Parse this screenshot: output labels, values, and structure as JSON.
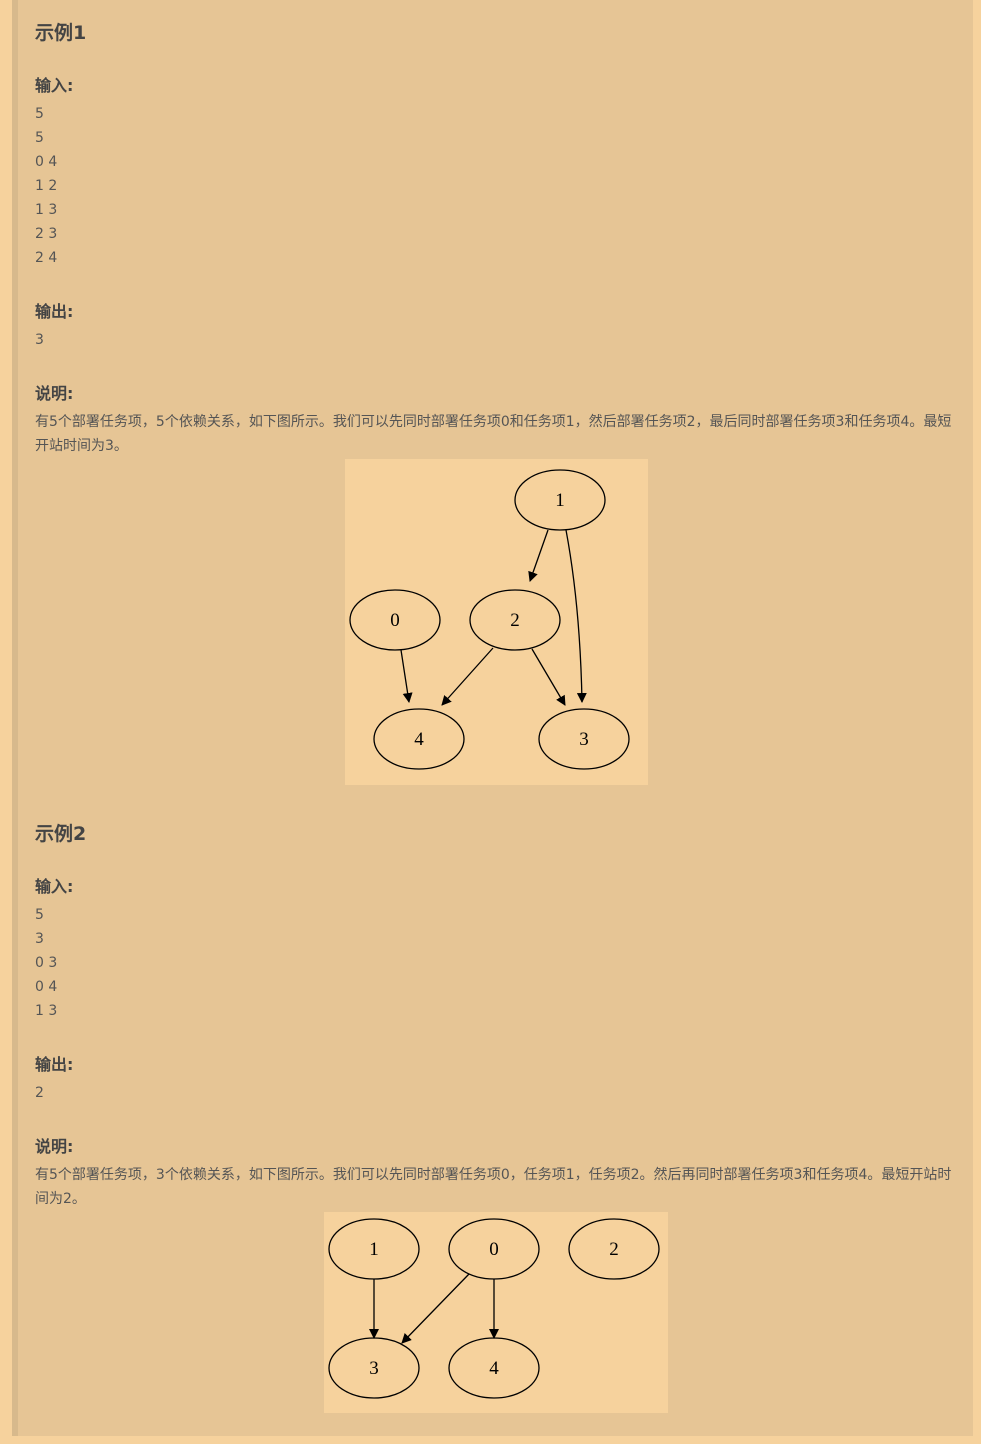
{
  "examples": [
    {
      "title": "示例1",
      "input_label": "输入:",
      "input_lines": [
        "5",
        "5",
        "0 4",
        "1 2",
        "1 3",
        "2 3",
        "2 4"
      ],
      "output_label": "输出:",
      "output_lines": [
        "3"
      ],
      "explain_label": "说明:",
      "explanation": "有5个部署任务项，5个依赖关系，如下图所示。我们可以先同时部署任务项0和任务项1，然后部署任务项2，最后同时部署任务项3和任务项4。最短开站时间为3。",
      "graph": {
        "nodes": [
          "1",
          "0",
          "2",
          "4",
          "3"
        ],
        "edges": [
          [
            "1",
            "2"
          ],
          [
            "1",
            "3"
          ],
          [
            "0",
            "4"
          ],
          [
            "2",
            "4"
          ],
          [
            "2",
            "3"
          ]
        ]
      }
    },
    {
      "title": "示例2",
      "input_label": "输入:",
      "input_lines": [
        "5",
        "3",
        "0 3",
        "0 4",
        "1 3"
      ],
      "output_label": "输出:",
      "output_lines": [
        "2"
      ],
      "explain_label": "说明:",
      "explanation": "有5个部署任务项，3个依赖关系，如下图所示。我们可以先同时部署任务项0，任务项1，任务项2。然后再同时部署任务项3和任务项4。最短开站时间为2。",
      "graph": {
        "nodes": [
          "1",
          "0",
          "2",
          "3",
          "4"
        ],
        "edges": [
          [
            "1",
            "3"
          ],
          [
            "0",
            "3"
          ],
          [
            "0",
            "4"
          ]
        ]
      }
    }
  ]
}
